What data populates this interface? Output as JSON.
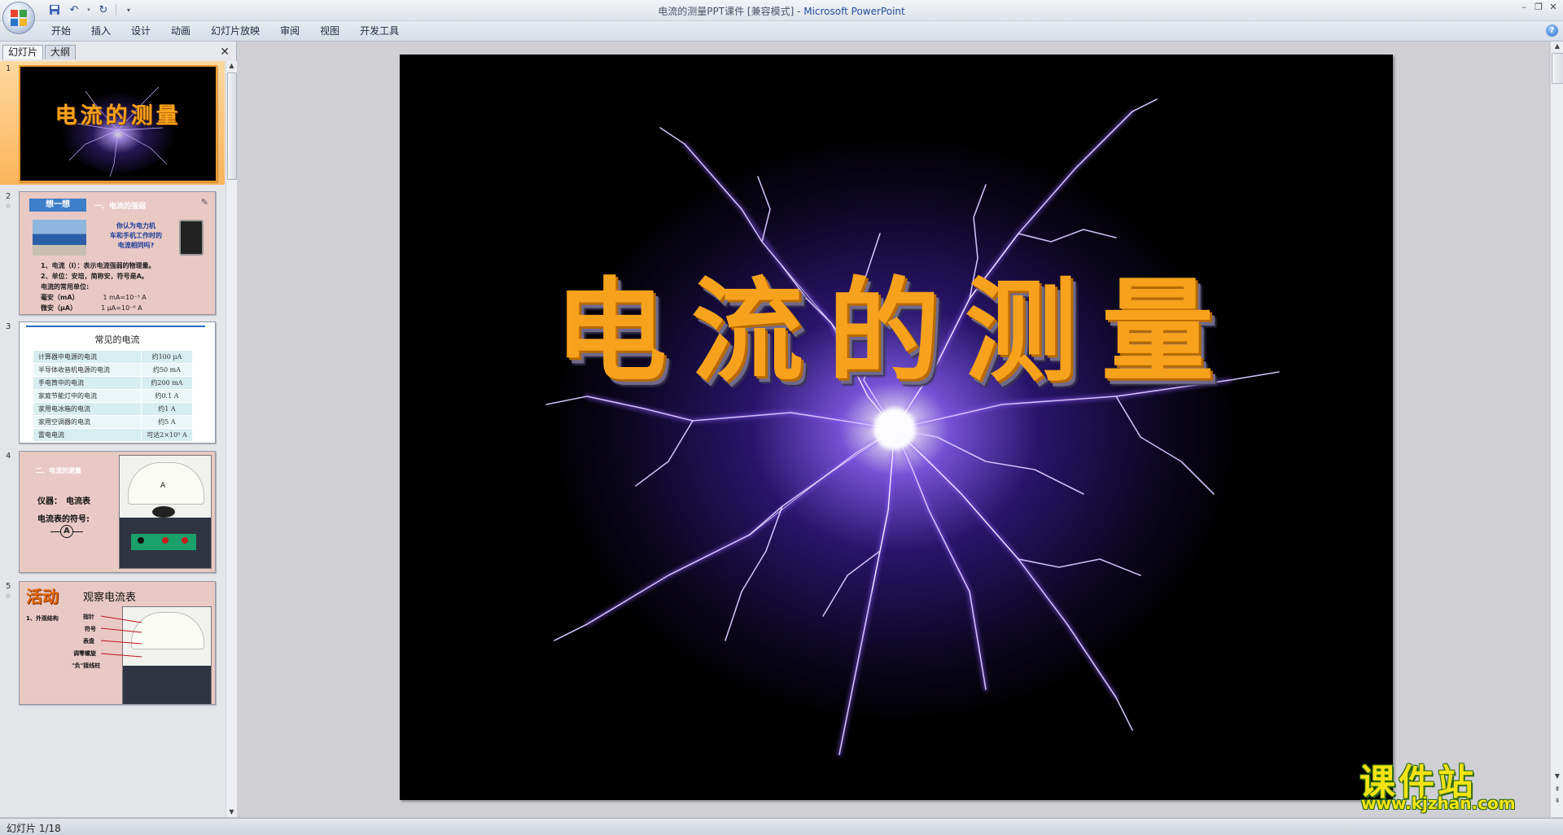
{
  "window": {
    "title": "电流的测量PPT课件 [兼容模式]",
    "separator": " - ",
    "app_name": "Microsoft PowerPoint"
  },
  "ribbon": {
    "tabs": [
      "开始",
      "插入",
      "设计",
      "动画",
      "幻灯片放映",
      "审阅",
      "视图",
      "开发工具"
    ]
  },
  "left_pane": {
    "tab_slides": "幻灯片",
    "tab_outline": "大纲"
  },
  "thumbnails": {
    "s1": {
      "num": "1",
      "title": "电流的测量"
    },
    "s2": {
      "num": "2",
      "badge": "想一想",
      "heading": "一、电流的强弱",
      "question": [
        "你认为电力机",
        "车和手机工作时的",
        "电流相同吗?"
      ],
      "line1": "1、电流（I）：表示电流强弱的物理量。",
      "line2": "2、单位：安培，简称安，符号是A。",
      "line3": "电流的常用单位:",
      "line4_label": "毫安（mA）",
      "line4_value": "1 mA=10⁻³ A",
      "line5_label": "微安（μA）",
      "line5_value": "1 μA=10⁻⁶ A"
    },
    "s3": {
      "num": "3",
      "title": "常见的电流",
      "rows": [
        [
          "计算器中电源的电流",
          "约100 μA"
        ],
        [
          "半导体收音机电源的电流",
          "约50 mA"
        ],
        [
          "手电筒中的电流",
          "约200 mA"
        ],
        [
          "家庭节能灯中的电流",
          "约0.1 A"
        ],
        [
          "家用电冰箱的电流",
          "约1 A"
        ],
        [
          "家用空调器的电流",
          "约5 A"
        ],
        [
          "雷电电流",
          "可达2×10⁵ A"
        ]
      ]
    },
    "s4": {
      "num": "4",
      "heading": "二、电流的测量",
      "instrument": "仪器：　电流表",
      "symbol_label": "电流表的符号:",
      "symbol": "A",
      "meter_letter": "A"
    },
    "s5": {
      "num": "5",
      "badge": "活动",
      "title": "观察电流表",
      "sub": "1、外观结构",
      "labels": [
        "指针",
        "符号",
        "表盘",
        "调零螺旋",
        "\"负\"接线柱"
      ]
    }
  },
  "slide": {
    "title": "电流的测量"
  },
  "status": {
    "text": "幻灯片 1/18"
  },
  "watermark": {
    "line1": "课件站",
    "line2": "www.kjzhan.com"
  },
  "colors": {
    "title_orange": "#f7a21c",
    "lightning": "#b98cff",
    "selection": "#fbb45a"
  }
}
